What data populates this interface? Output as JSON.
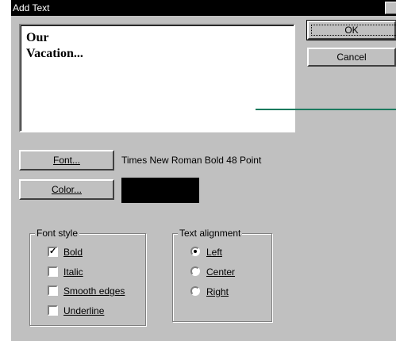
{
  "window": {
    "title": "Add Text"
  },
  "text_box": {
    "value": "Our\nVacation..."
  },
  "buttons": {
    "ok": "OK",
    "cancel": "Cancel",
    "font": "Font...",
    "color": "Color..."
  },
  "font": {
    "description": "Times New Roman Bold 48 Point"
  },
  "color": {
    "swatch": "#000000"
  },
  "font_style": {
    "legend": "Font style",
    "options": [
      {
        "label": "Bold",
        "checked": true
      },
      {
        "label": "Italic",
        "checked": false
      },
      {
        "label": "Smooth edges",
        "checked": false
      },
      {
        "label": "Underline",
        "checked": false
      }
    ]
  },
  "text_alignment": {
    "legend": "Text alignment",
    "options": [
      {
        "label": "Left",
        "selected": true
      },
      {
        "label": "Center",
        "selected": false
      },
      {
        "label": "Right",
        "selected": false
      }
    ]
  }
}
